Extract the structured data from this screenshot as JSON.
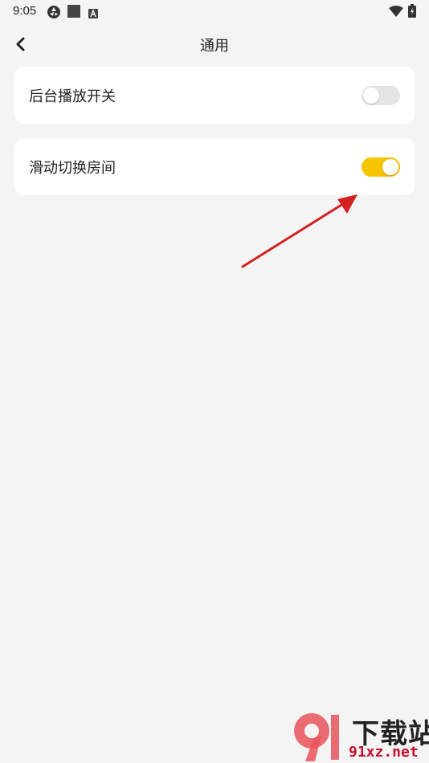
{
  "status_bar": {
    "time": "9:05",
    "icons": [
      "settings-aperture-icon",
      "square-icon",
      "keyboard-a-icon",
      "wifi-icon",
      "battery-charging-icon"
    ]
  },
  "header": {
    "title": "通用",
    "back_icon": "chevron-left-icon"
  },
  "settings": [
    {
      "label": "后台播放开关",
      "enabled": false
    },
    {
      "label": "滑动切换房间",
      "enabled": true
    }
  ],
  "colors": {
    "background": "#f4f4f4",
    "card": "#ffffff",
    "toggle_on": "#f7c400",
    "toggle_off": "#e4e4e4",
    "annotation_arrow": "#d42020"
  },
  "watermark": {
    "logo_text": "9",
    "title": "下载站",
    "domain": "91xz.net"
  }
}
